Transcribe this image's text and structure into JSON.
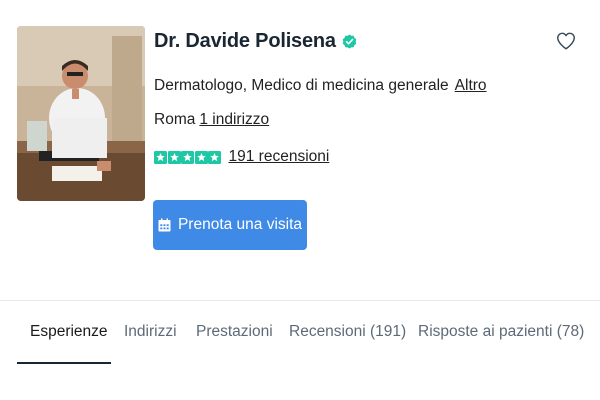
{
  "doctor": {
    "name": "Dr. Davide Polisena",
    "specialties": "Dermatologo, Medico di medicina generale",
    "more_label": "Altro",
    "city": "Roma",
    "addresses_label": "1 indirizzo",
    "rating_stars": 5,
    "reviews_label": "191 recensioni"
  },
  "actions": {
    "book_label": "Prenota una visita"
  },
  "icons": {
    "verified": "verified-check-icon",
    "favorite": "heart-outline-icon",
    "calendar": "calendar-icon",
    "star": "star-icon"
  },
  "colors": {
    "accent": "#3f8ae6",
    "star": "#1ec8a5",
    "verified": "#1ec8a5",
    "text": "#1a2733",
    "tab_inactive": "#5d6a77"
  },
  "tabs": [
    {
      "label": "Esperienze",
      "active": true
    },
    {
      "label": "Indirizzi",
      "active": false
    },
    {
      "label": "Prestazioni",
      "active": false
    },
    {
      "label": "Recensioni (191)",
      "active": false
    },
    {
      "label": "Risposte ai pazienti (78)",
      "active": false
    }
  ]
}
